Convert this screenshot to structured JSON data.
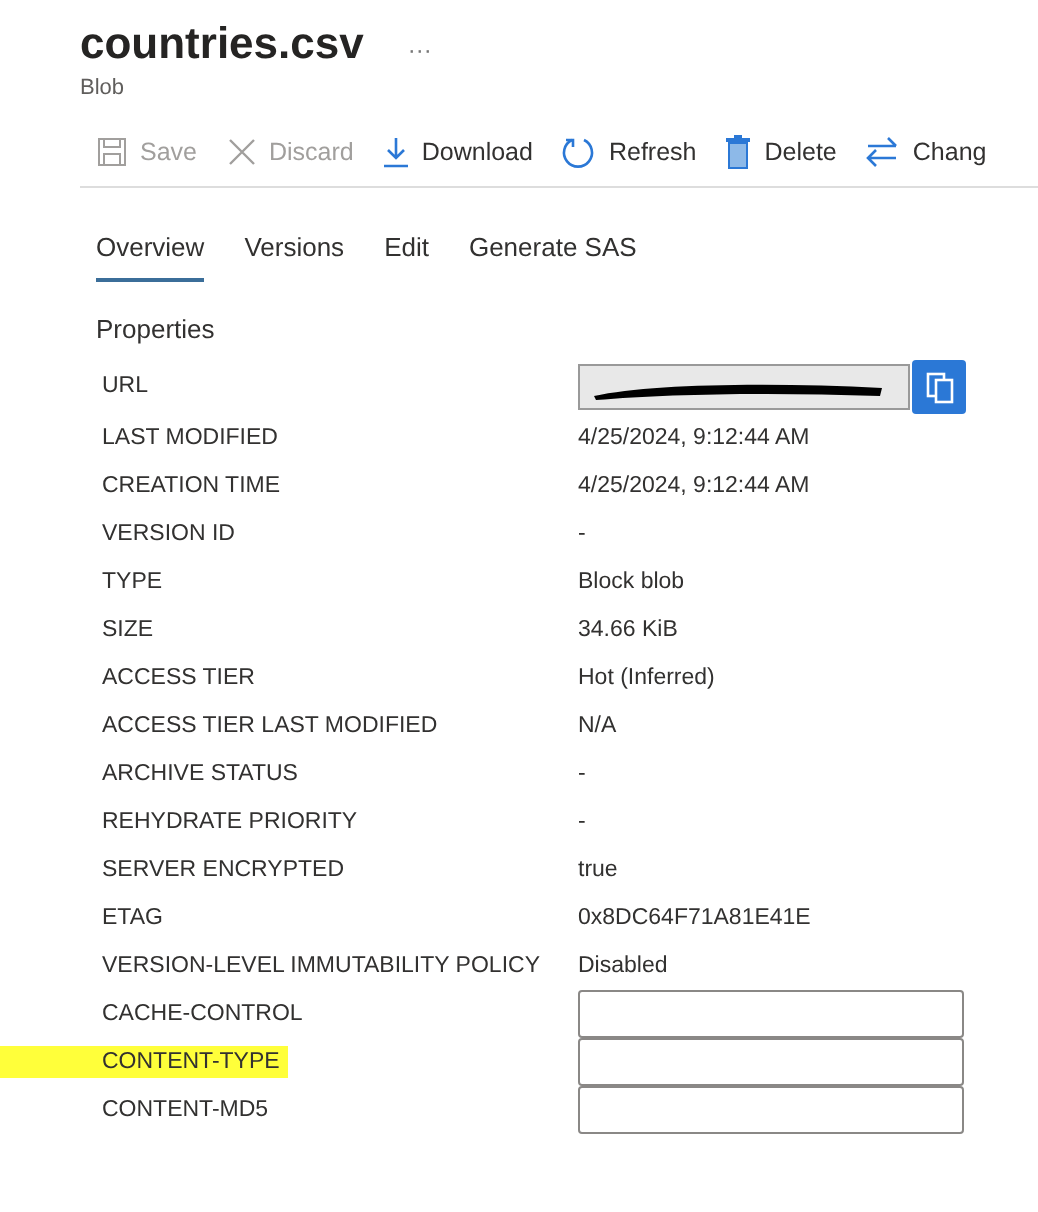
{
  "header": {
    "title": "countries.csv",
    "more": "···",
    "subtitle": "Blob"
  },
  "toolbar": [
    {
      "label": "Save",
      "kind": "save",
      "disabled": true
    },
    {
      "label": "Discard",
      "kind": "discard",
      "disabled": true
    },
    {
      "label": "Download",
      "kind": "download",
      "disabled": false
    },
    {
      "label": "Refresh",
      "kind": "refresh",
      "disabled": false
    },
    {
      "label": "Delete",
      "kind": "delete",
      "disabled": false
    },
    {
      "label": "Chang",
      "kind": "change",
      "disabled": false
    }
  ],
  "tabs": [
    {
      "label": "Overview",
      "selected": true
    },
    {
      "label": "Versions",
      "selected": false
    },
    {
      "label": "Edit",
      "selected": false
    },
    {
      "label": "Generate SAS",
      "selected": false
    }
  ],
  "properties": {
    "heading": "Properties",
    "rows": [
      {
        "kind": "url",
        "label": "URL",
        "redacted": true
      },
      {
        "kind": "text",
        "label": "LAST MODIFIED",
        "value": "4/25/2024, 9:12:44 AM"
      },
      {
        "kind": "text",
        "label": "CREATION TIME",
        "value": "4/25/2024, 9:12:44 AM"
      },
      {
        "kind": "text",
        "label": "VERSION ID",
        "value": "-"
      },
      {
        "kind": "text",
        "label": "TYPE",
        "value": "Block blob"
      },
      {
        "kind": "text",
        "label": "SIZE",
        "value": "34.66 KiB"
      },
      {
        "kind": "text",
        "label": "ACCESS TIER",
        "value": "Hot (Inferred)"
      },
      {
        "kind": "text",
        "label": "ACCESS TIER LAST MODIFIED",
        "value": "N/A"
      },
      {
        "kind": "text",
        "label": "ARCHIVE STATUS",
        "value": "-"
      },
      {
        "kind": "text",
        "label": "REHYDRATE PRIORITY",
        "value": "-"
      },
      {
        "kind": "text",
        "label": "SERVER ENCRYPTED",
        "value": "true"
      },
      {
        "kind": "text",
        "label": "ETAG",
        "value": "0x8DC64F71A81E41E"
      },
      {
        "kind": "text",
        "label": "VERSION-LEVEL IMMUTABILITY POLICY",
        "value": "Disabled"
      },
      {
        "kind": "input",
        "label": "CACHE-CONTROL",
        "highlighted": false
      },
      {
        "kind": "input",
        "label": "CONTENT-TYPE",
        "highlighted": true
      },
      {
        "kind": "input",
        "label": "CONTENT-MD5",
        "highlighted": false
      }
    ]
  }
}
